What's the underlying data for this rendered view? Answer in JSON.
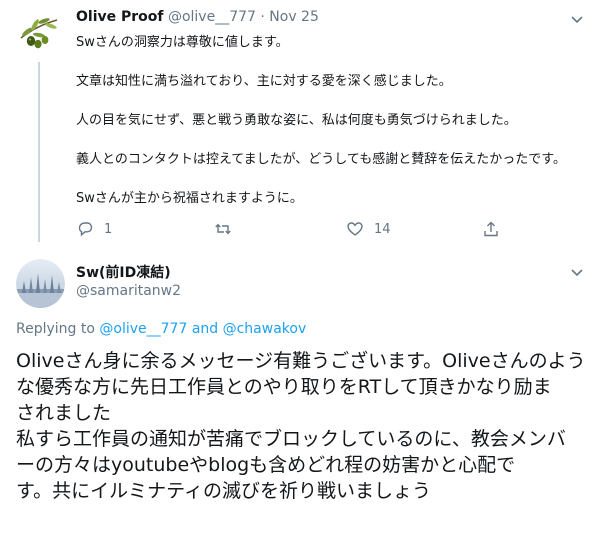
{
  "tweet1": {
    "name": "Olive Proof",
    "handle": "@olive__777",
    "separator": "·",
    "time": "Nov 25",
    "paragraphs": [
      "Swさんの洞察力は尊敬に値します。",
      "文章は知性に満ち溢れており、主に対する愛を深く感じました。",
      "人の目を気にせず、悪と戦う勇敢な姿に、私は何度も勇気づけられました。",
      "義人とのコンタクトは控えてましたが、どうしても感謝と賛辞を伝えたかったです。",
      "Swさんが主から祝福されますように。"
    ],
    "actions": {
      "reply_count": "1",
      "retweet_count": "",
      "like_count": "14"
    },
    "icons": [
      "olive-avatar",
      "chevron-down-icon",
      "reply-icon",
      "retweet-icon",
      "like-icon",
      "share-icon"
    ]
  },
  "tweet2": {
    "name": "Sw(前ID凍結)",
    "handle": "@samaritanw2",
    "replying_prefix": "Replying to",
    "replying_user1": "@olive__777",
    "replying_and": "and",
    "replying_user2": "@chawakov",
    "lines": [
      "Oliveさん身に余るメッセージ有難うございます。Oliveさんのよう",
      "な優秀な方に先日工作員とのやり取りをRTして頂きかなり励ま",
      "されました",
      "私すら工作員の通知が苦痛でブロックしているのに、教会メンバ",
      "ーの方々はyoutubeやblogも含めどれ程の妨害かと心配で",
      "す。共にイルミナティの滅びを祈り戦いましょう"
    ]
  },
  "colors": {
    "text": "#14171a",
    "muted": "#657786",
    "link": "#1da1f2",
    "divider": "#ccd6dd"
  }
}
